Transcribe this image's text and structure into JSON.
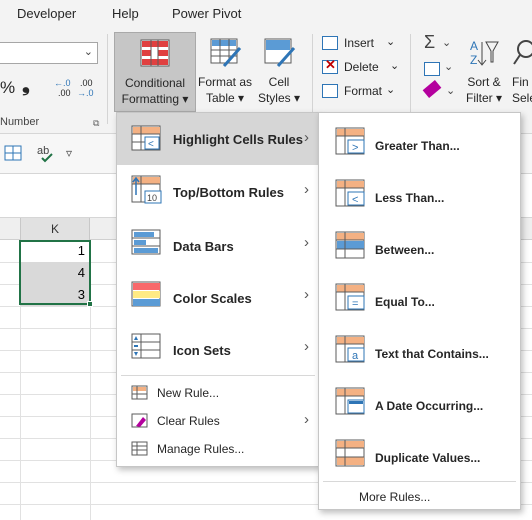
{
  "tabs": [
    "Developer",
    "Help",
    "Power Pivot"
  ],
  "ribbon": {
    "percent": "%",
    "comma": "❟",
    "dec_increase": "←.0\n.00",
    "dec_decrease": ".00\n→.0",
    "number_group": "Number",
    "conditional_formatting": [
      "Conditional",
      "Formatting ▾"
    ],
    "format_as_table": [
      "Format as",
      "Table ▾"
    ],
    "cell_styles": [
      "Cell",
      "Styles ▾"
    ],
    "insert": "Insert",
    "delete": "Delete",
    "format": "Format",
    "sort_filter": [
      "Sort &",
      "Filter ▾"
    ],
    "find_select": [
      "Fin",
      "Sele"
    ],
    "sigma": "Σ",
    "sort_icon": "A Z"
  },
  "sheet": {
    "column_k": "K",
    "values": [
      "1",
      "4",
      "3"
    ]
  },
  "menu_main": {
    "items": [
      {
        "label": "Highlight Cells Rules"
      },
      {
        "label": "Top/Bottom Rules"
      },
      {
        "label": "Data Bars"
      },
      {
        "label": "Color Scales"
      },
      {
        "label": "Icon Sets"
      }
    ],
    "small_items": [
      {
        "label": "New Rule..."
      },
      {
        "label": "Clear Rules"
      },
      {
        "label": "Manage Rules..."
      }
    ]
  },
  "menu_sub": {
    "items": [
      {
        "label": "Greater Than..."
      },
      {
        "label": "Less Than..."
      },
      {
        "label": "Between..."
      },
      {
        "label": "Equal To..."
      },
      {
        "label": "Text that Contains..."
      },
      {
        "label": "A Date Occurring..."
      },
      {
        "label": "Duplicate Values..."
      }
    ],
    "more": "More Rules..."
  },
  "colors": {
    "accent_green": "#217346",
    "orange": "#f4b183",
    "blue": "#5b9bd5",
    "hover_gray": "#d6d6d6"
  },
  "icons": [
    "conditional-formatting-icon",
    "format-as-table-icon",
    "cell-styles-icon",
    "insert-icon",
    "delete-icon",
    "format-icon",
    "autosum-icon",
    "sort-filter-icon",
    "find-icon",
    "fill-icon",
    "eraser-icon"
  ]
}
